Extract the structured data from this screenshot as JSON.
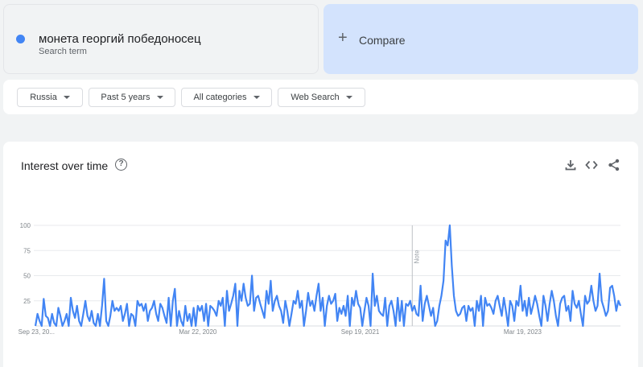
{
  "search_term": {
    "name": "монета георгий победоносец",
    "sub": "Search term",
    "color": "#4285f4"
  },
  "compare": {
    "label": "Compare"
  },
  "filters": [
    {
      "label": "Russia"
    },
    {
      "label": "Past 5 years"
    },
    {
      "label": "All categories"
    },
    {
      "label": "Web Search"
    }
  ],
  "chart_header": {
    "title": "Interest over time",
    "help_icon": "help-icon",
    "actions": [
      "download-icon",
      "embed-icon",
      "share-icon"
    ]
  },
  "chart_data": {
    "type": "line",
    "title": "Interest over time",
    "xlabel": "",
    "ylabel": "",
    "ylim": [
      0,
      100
    ],
    "yticks": [
      25,
      50,
      75,
      100
    ],
    "grid": true,
    "line_color": "#4285f4",
    "x_tick_labels": [
      "Sep 23, 20...",
      "Mar 22, 2020",
      "Sep 19, 2021",
      "Mar 19, 2023"
    ],
    "x_tick_index": [
      0,
      78,
      156,
      234
    ],
    "note": {
      "label": "Note",
      "index": 181
    },
    "series": [
      {
        "values": [
          0,
          12,
          5,
          0,
          27,
          10,
          8,
          0,
          12,
          3,
          0,
          18,
          10,
          0,
          5,
          12,
          0,
          28,
          15,
          8,
          20,
          5,
          0,
          12,
          25,
          10,
          5,
          15,
          3,
          0,
          12,
          0,
          20,
          47,
          5,
          0,
          10,
          25,
          15,
          18,
          15,
          20,
          5,
          12,
          22,
          0,
          12,
          10,
          0,
          25,
          20,
          22,
          15,
          22,
          5,
          15,
          18,
          25,
          12,
          5,
          22,
          18,
          10,
          3,
          28,
          0,
          25,
          37,
          0,
          15,
          5,
          0,
          20,
          5,
          12,
          0,
          18,
          0,
          20,
          15,
          20,
          5,
          22,
          0,
          20,
          18,
          15,
          10,
          25,
          20,
          28,
          0,
          35,
          15,
          22,
          30,
          42,
          0,
          35,
          25,
          42,
          28,
          20,
          22,
          50,
          15,
          28,
          30,
          22,
          15,
          8,
          35,
          22,
          45,
          15,
          25,
          30,
          20,
          15,
          3,
          25,
          15,
          0,
          12,
          25,
          22,
          35,
          18,
          25,
          0,
          15,
          33,
          20,
          25,
          15,
          30,
          42,
          15,
          28,
          0,
          20,
          30,
          22,
          25,
          32,
          5,
          18,
          12,
          20,
          10,
          30,
          0,
          28,
          20,
          35,
          22,
          18,
          0,
          15,
          28,
          20,
          0,
          52,
          20,
          30,
          15,
          12,
          10,
          28,
          0,
          20,
          25,
          15,
          0,
          28,
          5,
          25,
          0,
          22,
          20,
          25,
          15,
          20,
          12,
          10,
          40,
          5,
          22,
          30,
          20,
          10,
          18,
          0,
          5,
          20,
          30,
          45,
          85,
          80,
          100,
          60,
          30,
          15,
          10,
          12,
          18,
          20,
          5,
          20,
          15,
          18,
          0,
          25,
          15,
          30,
          0,
          28,
          20,
          22,
          18,
          12,
          25,
          30,
          20,
          10,
          28,
          15,
          0,
          25,
          20,
          5,
          25,
          20,
          40,
          15,
          25,
          10,
          28,
          12,
          20,
          30,
          22,
          10,
          0,
          30,
          20,
          5,
          22,
          35,
          25,
          10,
          0,
          22,
          28,
          30,
          15,
          20,
          5,
          35,
          22,
          18,
          25,
          12,
          0,
          30,
          22,
          25,
          40,
          25,
          15,
          20,
          52,
          25,
          18,
          10,
          15,
          38,
          40,
          30,
          15,
          25,
          20
        ]
      }
    ]
  }
}
